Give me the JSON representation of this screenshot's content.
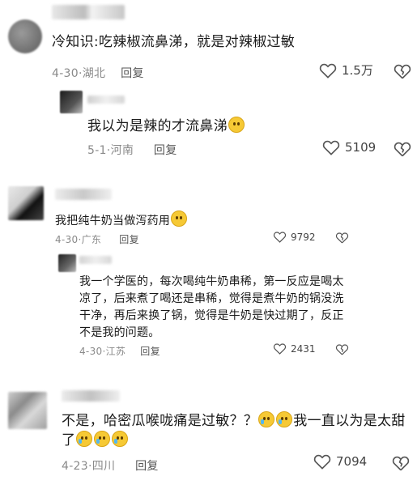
{
  "comments": [
    {
      "text": "冷知识:吃辣椒流鼻涕，就是对辣椒过敏",
      "date": "4-30",
      "location": "湖北",
      "reply_label": "回复",
      "likes": "1.5万",
      "replies": [
        {
          "text": "我以为是辣的才流鼻涕",
          "date": "5-1",
          "location": "河南",
          "reply_label": "回复",
          "likes": "5109"
        }
      ]
    },
    {
      "text": "我把纯牛奶当做泻药用",
      "date": "4-30",
      "location": "广东",
      "reply_label": "回复",
      "likes": "9792",
      "replies": [
        {
          "text": "我一个学医的，每次喝纯牛奶串稀，第一反应是喝太凉了，后来煮了喝还是串稀，觉得是煮牛奶的锅没洗干净，再后来换了锅，觉得是牛奶是快过期了，反正不是我的问题。",
          "date": "4-30",
          "location": "江苏",
          "reply_label": "回复",
          "likes": "2431"
        }
      ]
    },
    {
      "text_a": "不是，哈密瓜喉咙痛是过敏？？",
      "text_b": "我一直以为是太甜了",
      "date": "4-23",
      "location": "四川",
      "reply_label": "回复",
      "likes": "7094"
    }
  ],
  "icons": {
    "like": "heart-outline-icon",
    "dislike": "broken-heart-outline-icon",
    "emoji_laugh": "tears-of-joy-emoji",
    "emoji_blush": "blush-emoji",
    "emoji_cry": "crying-emoji"
  },
  "colors": {
    "text": "#1a1a1a",
    "meta": "#8a8a8a",
    "avatar_gray": "#8d8d8d"
  }
}
